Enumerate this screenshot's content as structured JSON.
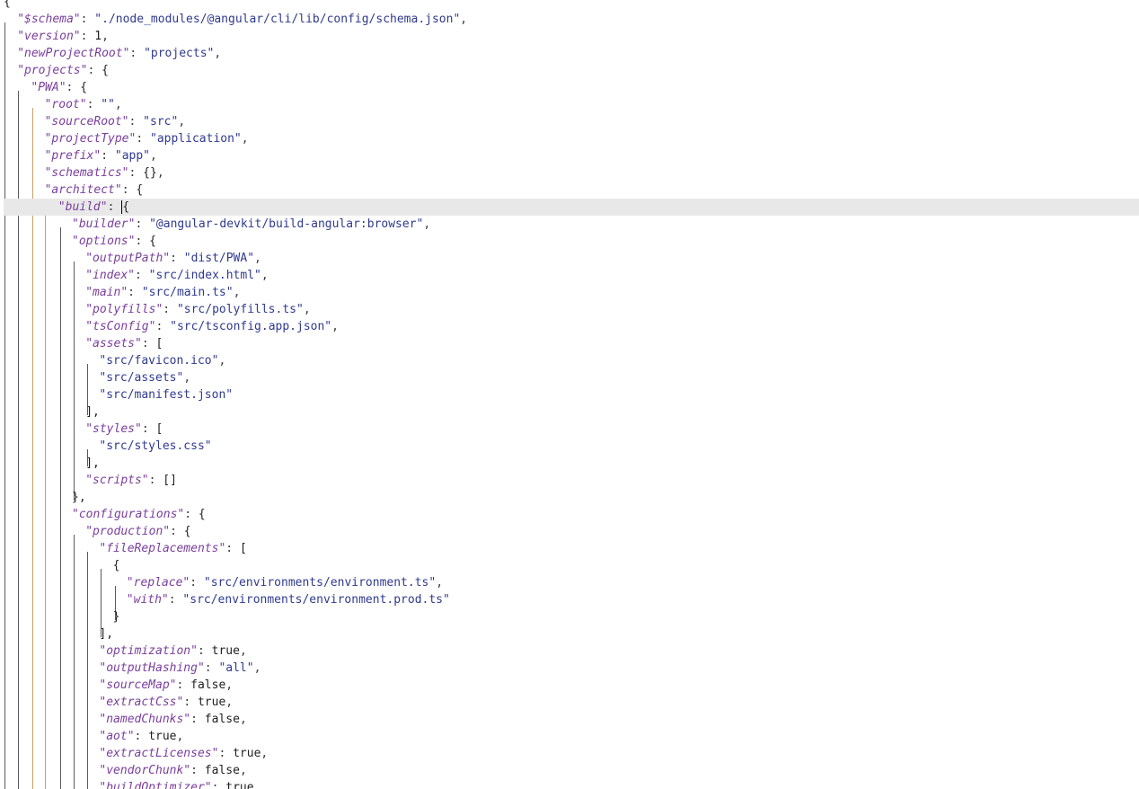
{
  "editor": {
    "document_kind": "angular.json",
    "lines": [
      {
        "text": "{"
      },
      {
        "key": "$schema",
        "value": "\"./node_modules/@angular/cli/lib/config/schema.json\"",
        "suffix": ","
      },
      {
        "key": "version",
        "value": "1",
        "suffix": ","
      },
      {
        "key": "newProjectRoot",
        "value": "\"projects\"",
        "suffix": ","
      },
      {
        "key": "projects",
        "value": "{",
        "suffix": ""
      },
      {
        "key": "PWA",
        "value": "{",
        "suffix": ""
      },
      {
        "key": "root",
        "value": "\"\"",
        "suffix": ","
      },
      {
        "key": "sourceRoot",
        "value": "\"src\"",
        "suffix": ","
      },
      {
        "key": "projectType",
        "value": "\"application\"",
        "suffix": ","
      },
      {
        "key": "prefix",
        "value": "\"app\"",
        "suffix": ","
      },
      {
        "key": "schematics",
        "value": "{}",
        "suffix": ","
      },
      {
        "key": "architect",
        "value": "{",
        "suffix": ""
      },
      {
        "key": "build",
        "value": "{",
        "suffix": "",
        "active": true
      },
      {
        "key": "builder",
        "value": "\"@angular-devkit/build-angular:browser\"",
        "suffix": ","
      },
      {
        "key": "options",
        "value": "{",
        "suffix": ""
      },
      {
        "key": "outputPath",
        "value": "\"dist/PWA\"",
        "suffix": ","
      },
      {
        "key": "index",
        "value": "\"src/index.html\"",
        "suffix": ","
      },
      {
        "key": "main",
        "value": "\"src/main.ts\"",
        "suffix": ","
      },
      {
        "key": "polyfills",
        "value": "\"src/polyfills.ts\"",
        "suffix": ","
      },
      {
        "key": "tsConfig",
        "value": "\"src/tsconfig.app.json\"",
        "suffix": ","
      },
      {
        "key": "assets",
        "value": "[",
        "suffix": ""
      },
      {
        "value": "\"src/favicon.ico\"",
        "suffix": ","
      },
      {
        "value": "\"src/assets\"",
        "suffix": ","
      },
      {
        "value": "\"src/manifest.json\"",
        "suffix": ""
      },
      {
        "text": "],"
      },
      {
        "key": "styles",
        "value": "[",
        "suffix": ""
      },
      {
        "value": "\"src/styles.css\"",
        "suffix": ""
      },
      {
        "text": "],"
      },
      {
        "key": "scripts",
        "value": "[]",
        "suffix": ""
      },
      {
        "text": "},"
      },
      {
        "key": "configurations",
        "value": "{",
        "suffix": ""
      },
      {
        "key": "production",
        "value": "{",
        "suffix": ""
      },
      {
        "key": "fileReplacements",
        "value": "[",
        "suffix": ""
      },
      {
        "text": "{"
      },
      {
        "key": "replace",
        "value": "\"src/environments/environment.ts\"",
        "suffix": ","
      },
      {
        "key": "with",
        "value": "\"src/environments/environment.prod.ts\"",
        "suffix": ""
      },
      {
        "text": "}"
      },
      {
        "text": "],"
      },
      {
        "key": "optimization",
        "value": "true",
        "suffix": ","
      },
      {
        "key": "outputHashing",
        "value": "\"all\"",
        "suffix": ","
      },
      {
        "key": "sourceMap",
        "value": "false",
        "suffix": ","
      },
      {
        "key": "extractCss",
        "value": "true",
        "suffix": ","
      },
      {
        "key": "namedChunks",
        "value": "false",
        "suffix": ","
      },
      {
        "key": "aot",
        "value": "true",
        "suffix": ","
      },
      {
        "key": "extractLicenses",
        "value": "true",
        "suffix": ","
      },
      {
        "key": "vendorChunk",
        "value": "false",
        "suffix": ","
      },
      {
        "key": "buildOptimizer",
        "value": "true",
        "suffix": ","
      }
    ],
    "colors": {
      "key": "#7a3e9d",
      "string": "#2f3a8f",
      "punct": "#3c3c3c",
      "active_line": "#e8e8e8",
      "guide_dark": "#5a5a5a",
      "guide_gold": "#c8a062",
      "guide_light": "#b0b0b0"
    }
  }
}
